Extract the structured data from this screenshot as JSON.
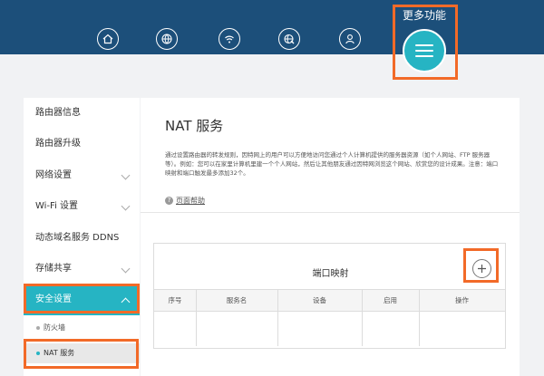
{
  "nav": {
    "icons": [
      "home-icon",
      "globe-icon",
      "wifi-icon",
      "network-icon",
      "user-icon"
    ],
    "more_label": "更多功能",
    "menu_icon": "hamburger-menu-icon"
  },
  "sidebar": {
    "items": [
      {
        "label": "路由器信息"
      },
      {
        "label": "路由器升级"
      },
      {
        "label": "网络设置"
      },
      {
        "label": "Wi-Fi 设置"
      },
      {
        "label": "动态域名服务 DDNS"
      },
      {
        "label": "存储共享"
      },
      {
        "label": "安全设置"
      }
    ],
    "subitems": [
      {
        "label": "防火墙"
      },
      {
        "label": "NAT 服务"
      }
    ]
  },
  "main": {
    "title": "NAT 服务",
    "description": "通过设置路由器的转发规则，因特网上的用户可以方便地访问您通过个人计算机提供的服务器资源（如个人网站、FTP 服务器等）。例如：您可以在家里计算机里建一个个人网站，然后让其他朋友通过因特网浏览这个网站、欣赏您的设计成果。注意：端口映射和端口触发最多添加32个。",
    "help_label": "页面帮助",
    "panel_title": "端口映射",
    "columns": [
      "序号",
      "服务名",
      "设备",
      "启用",
      "操作"
    ]
  },
  "colors": {
    "topbar": "#1c4f7a",
    "accent": "#26b4c3",
    "highlight": "#f26a28"
  }
}
